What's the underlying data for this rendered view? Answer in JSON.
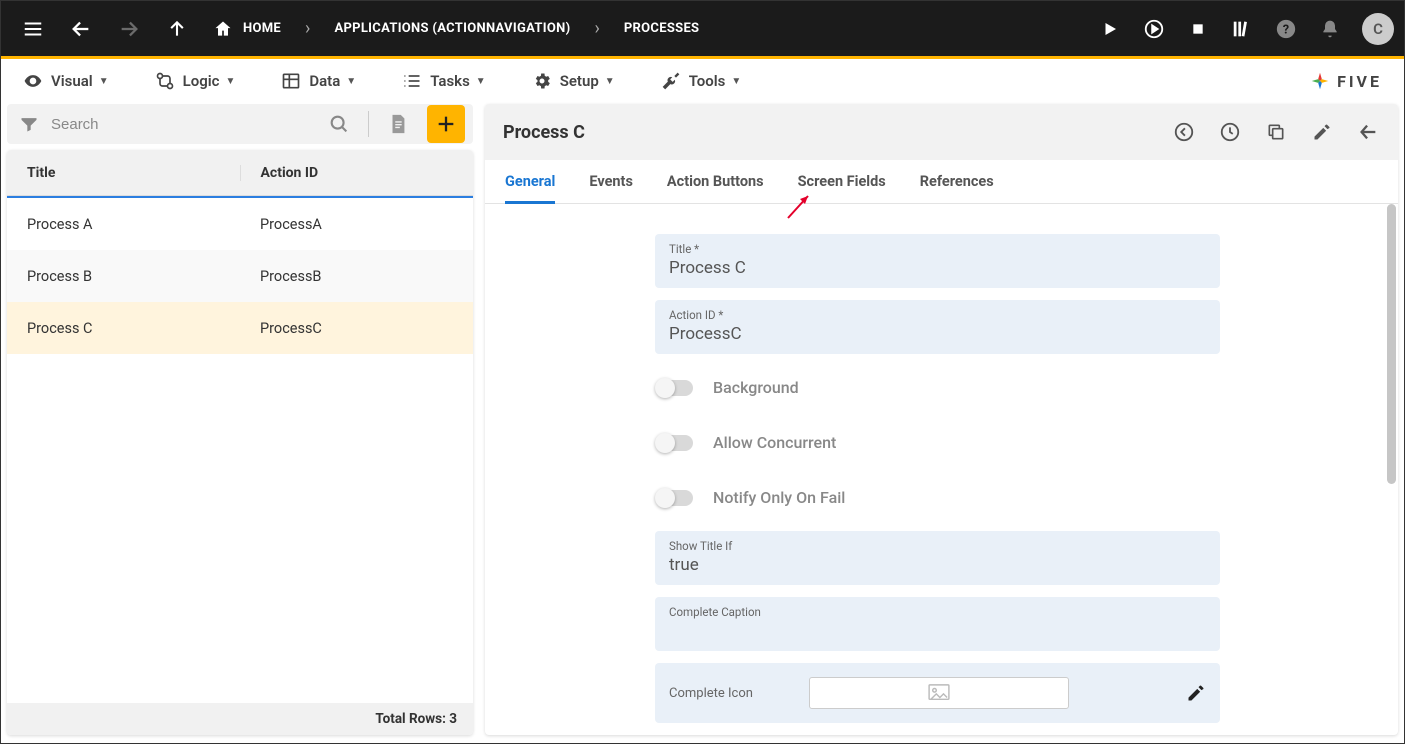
{
  "breadcrumbs": {
    "home": "HOME",
    "app": "APPLICATIONS (ACTIONNAVIGATION)",
    "section": "PROCESSES"
  },
  "avatar_letter": "C",
  "menu": {
    "visual": "Visual",
    "logic": "Logic",
    "data": "Data",
    "tasks": "Tasks",
    "setup": "Setup",
    "tools": "Tools"
  },
  "brand": "FIVE",
  "search": {
    "placeholder": "Search"
  },
  "table": {
    "col1": "Title",
    "col2": "Action ID",
    "rows": [
      {
        "title": "Process A",
        "action_id": "ProcessA"
      },
      {
        "title": "Process B",
        "action_id": "ProcessB"
      },
      {
        "title": "Process C",
        "action_id": "ProcessC"
      }
    ],
    "footer": "Total Rows: 3"
  },
  "detail": {
    "title": "Process C",
    "tabs": {
      "general": "General",
      "events": "Events",
      "action_buttons": "Action Buttons",
      "screen_fields": "Screen Fields",
      "references": "References"
    },
    "fields": {
      "title_label": "Title *",
      "title_value": "Process C",
      "actionid_label": "Action ID *",
      "actionid_value": "ProcessC",
      "background_label": "Background",
      "allow_concurrent_label": "Allow Concurrent",
      "notify_fail_label": "Notify Only On Fail",
      "show_title_if_label": "Show Title If",
      "show_title_if_value": "true",
      "complete_caption_label": "Complete Caption",
      "complete_caption_value": "",
      "complete_icon_label": "Complete Icon"
    }
  }
}
